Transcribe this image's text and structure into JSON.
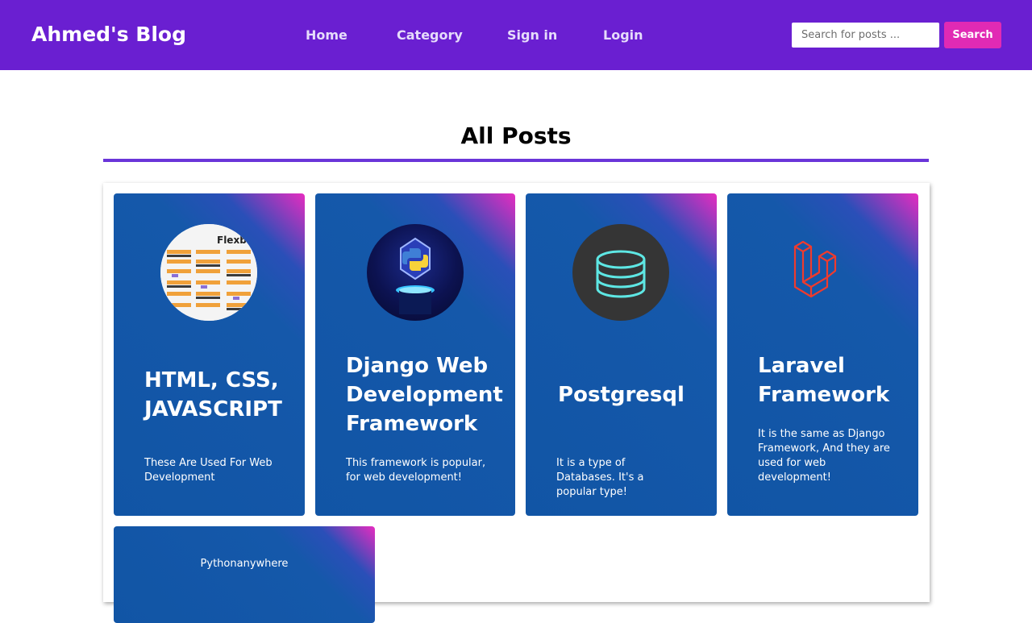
{
  "navbar": {
    "brand": "Ahmed's Blog",
    "links": [
      "Home",
      "Category",
      "Sign in",
      "Login"
    ],
    "search_placeholder": "Search for posts ...",
    "search_button": "Search"
  },
  "main": {
    "title": "All Posts"
  },
  "posts": [
    {
      "title": "HTML, CSS, JAVASCRIPT",
      "description": "These Are Used For Web Development",
      "image": "flexbox-cheatsheet"
    },
    {
      "title": "Django Web Development Framework",
      "description": "This framework is popular, for web development!",
      "image": "python-logo"
    },
    {
      "title": "Postgresql",
      "description": "It is a type of Databases. It's a popular type!",
      "image": "database-icon"
    },
    {
      "title": "Laravel Framework",
      "description": "It is the same as Django Framework, And they are used for web development!",
      "image": "laravel-logo"
    },
    {
      "title": "Pythonanywhere",
      "description": "",
      "image": ""
    }
  ],
  "colors": {
    "navbar_bg": "#6a1fd1",
    "accent_pink": "#e12ab4",
    "card_blue": "#1155a5"
  }
}
